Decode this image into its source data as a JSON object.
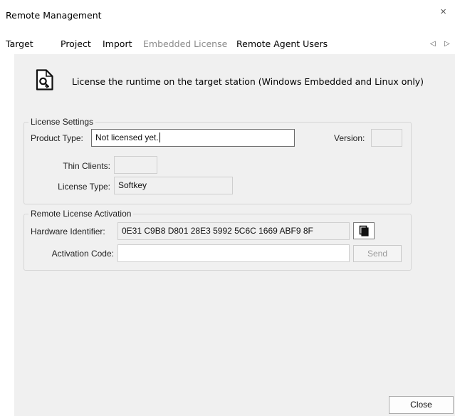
{
  "dialog": {
    "title": "Remote Management",
    "close_glyph": "×"
  },
  "tabs": [
    {
      "label": "Target",
      "enabled": true
    },
    {
      "label": "Project",
      "enabled": true
    },
    {
      "label": "Import",
      "enabled": true
    },
    {
      "label": "Embedded License",
      "enabled": false
    },
    {
      "label": "Remote Agent Users",
      "enabled": true
    }
  ],
  "tab_scroll": {
    "left": "◁",
    "right": "▷"
  },
  "headline": {
    "icon": "license-document-icon",
    "text": "License the runtime on the target station (Windows Embedded and Linux only)"
  },
  "license_settings": {
    "legend": "License Settings",
    "product_type_label": "Product Type:",
    "product_type_value": "Not licensed yet.",
    "version_label": "Version:",
    "version_value": "",
    "thin_clients_label": "Thin Clients:",
    "thin_clients_value": "",
    "license_type_label": "License Type:",
    "license_type_value": "Softkey"
  },
  "remote_activation": {
    "legend": "Remote License Activation",
    "hardware_id_label": "Hardware Identifier:",
    "hardware_id_value": "0E31 C9B8 D801 28E3 5992 5C6C 1669 ABF9 8F",
    "copy_icon": "copy-icon",
    "activation_code_label": "Activation Code:",
    "activation_code_value": "",
    "send_label": "Send"
  },
  "footer": {
    "close_label": "Close"
  }
}
